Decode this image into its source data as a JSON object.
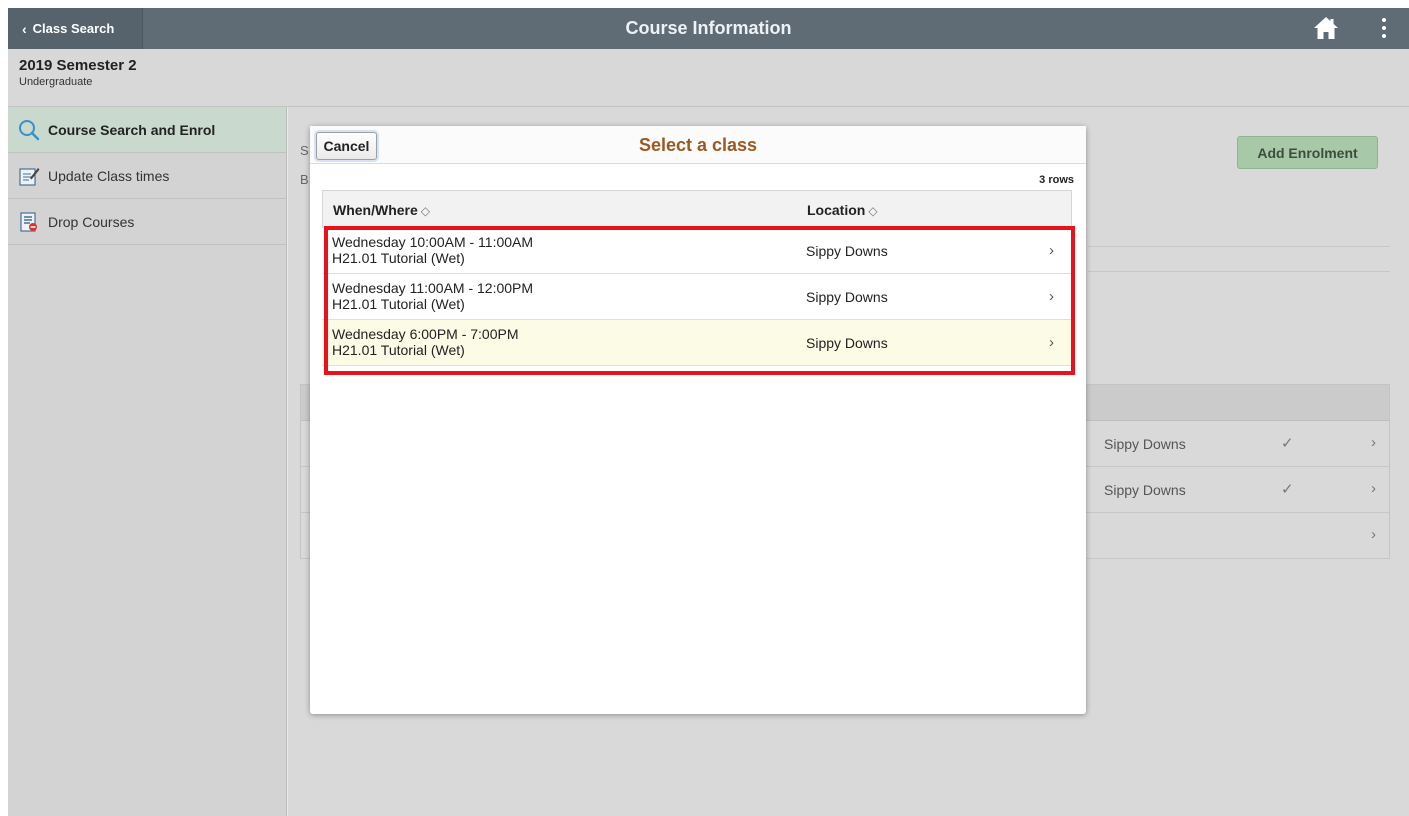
{
  "banner": {
    "back_label": "Class Search",
    "title": "Course Information"
  },
  "term": {
    "title": "2019 Semester 2",
    "subtitle": "Undergraduate"
  },
  "sidebar": {
    "items": [
      {
        "label": "Course Search and Enrol",
        "icon": "search-icon",
        "active": true
      },
      {
        "label": "Update Class times",
        "icon": "edit-note-icon",
        "active": false
      },
      {
        "label": "Drop Courses",
        "icon": "drop-list-icon",
        "active": false
      }
    ]
  },
  "background": {
    "letters": [
      "S",
      "B"
    ],
    "add_enrolment_label": "Add Enrolment",
    "rows": [
      {
        "location": "Sippy Downs",
        "check": "✓",
        "arrow": "›"
      },
      {
        "location": "Sippy Downs",
        "check": "✓",
        "arrow": "›"
      },
      {
        "location": "",
        "check": "",
        "arrow": "›"
      }
    ]
  },
  "modal": {
    "cancel_label": "Cancel",
    "title": "Select a class",
    "row_count": "3 rows",
    "columns": {
      "when_where": "When/Where",
      "location": "Location",
      "sort_icon": "◇"
    },
    "rows": [
      {
        "time": "Wednesday 10:00AM - 11:00AM",
        "section": "H21.01 Tutorial (Wet)",
        "location": "Sippy Downs"
      },
      {
        "time": "Wednesday 11:00AM - 12:00PM",
        "section": "H21.01 Tutorial (Wet)",
        "location": "Sippy Downs"
      },
      {
        "time": "Wednesday 6:00PM - 7:00PM",
        "section": "H21.01 Tutorial (Wet)",
        "location": "Sippy Downs"
      }
    ],
    "row_arrow": "›"
  },
  "colors": {
    "banner": "#5f6b75",
    "modal_title": "#9a5a1f",
    "highlight_box": "#e8121c",
    "add_enrolment": "#a8c9a8"
  }
}
